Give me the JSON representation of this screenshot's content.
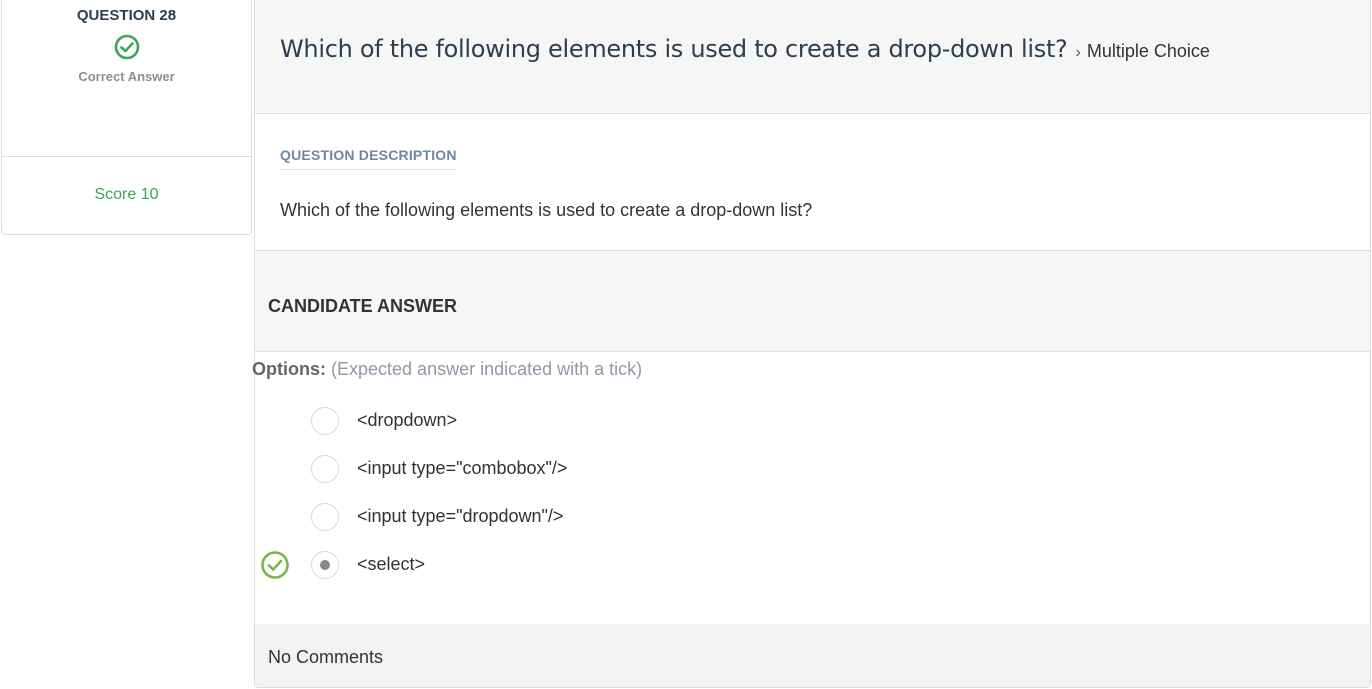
{
  "sidebar": {
    "question_label": "QUESTION 28",
    "status_icon": "check-circle-icon",
    "status_text": "Correct Answer",
    "score": "Score 10"
  },
  "question": {
    "title": "Which of the following elements is used to create a drop-down list?",
    "type": "Multiple Choice",
    "description_label": "QUESTION DESCRIPTION",
    "description": "Which of the following elements is used to create a drop-down list?"
  },
  "candidate": {
    "header": "CANDIDATE ANSWER",
    "options_label": "Options:",
    "options_hint": "(Expected answer indicated with a tick)",
    "options": [
      {
        "text": "<dropdown>",
        "selected": false,
        "expected": false
      },
      {
        "text": "<input type=\"combobox\"/>",
        "selected": false,
        "expected": false
      },
      {
        "text": "<input type=\"dropdown\"/>",
        "selected": false,
        "expected": false
      },
      {
        "text": "<select>",
        "selected": true,
        "expected": true
      }
    ]
  },
  "comments": "No Comments",
  "colors": {
    "correct_green": "#3aa757",
    "tick_green": "#7ab648",
    "title_navy": "#2d3e50"
  }
}
